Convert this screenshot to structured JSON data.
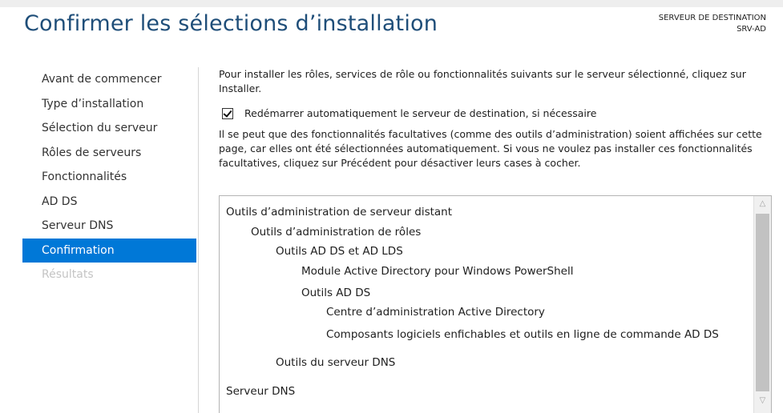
{
  "page": {
    "title": "Confirmer les sélections d’installation",
    "destination_label": "SERVEUR DE DESTINATION",
    "destination_server": "SRV-AD"
  },
  "sidebar": {
    "items": [
      {
        "label": "Avant de commencer",
        "state": "normal"
      },
      {
        "label": "Type d’installation",
        "state": "normal"
      },
      {
        "label": "Sélection du serveur",
        "state": "normal"
      },
      {
        "label": "Rôles de serveurs",
        "state": "normal"
      },
      {
        "label": "Fonctionnalités",
        "state": "normal"
      },
      {
        "label": "AD DS",
        "state": "normal"
      },
      {
        "label": "Serveur DNS",
        "state": "normal"
      },
      {
        "label": "Confirmation",
        "state": "active"
      },
      {
        "label": "Résultats",
        "state": "disabled"
      }
    ]
  },
  "content": {
    "intro": "Pour installer les rôles, services de rôle ou fonctionnalités suivants sur le serveur sélectionné, cliquez sur Installer.",
    "restart_checkbox": {
      "label": "Redémarrer automatiquement le serveur de destination, si nécessaire",
      "checked": true
    },
    "note": "Il se peut que des fonctionnalités facultatives (comme des outils d’administration) soient affichées sur cette page, car elles ont été sélectionnées automatiquement. Si vous ne voulez pas installer ces fonctionnalités facultatives, cliquez sur Précédent pour désactiver leurs cases à cocher."
  },
  "features_list": [
    {
      "label": "Outils d’administration de serveur distant",
      "level": 0
    },
    {
      "label": "Outils d’administration de rôles",
      "level": 1
    },
    {
      "label": "Outils AD DS et AD LDS",
      "level": 2
    },
    {
      "label": "Module Active Directory pour Windows PowerShell",
      "level": 3
    },
    {
      "label": "Outils AD DS",
      "level": 3
    },
    {
      "label": "Centre d’administration Active Directory",
      "level": 4
    },
    {
      "label": "Composants logiciels enfichables et outils en ligne de commande AD DS",
      "level": 4
    },
    {
      "label": "Outils du serveur DNS",
      "level": 2
    },
    {
      "label": "Serveur DNS",
      "level": 0
    }
  ],
  "colors": {
    "accent": "#0078d7",
    "title": "#1f4e79"
  }
}
